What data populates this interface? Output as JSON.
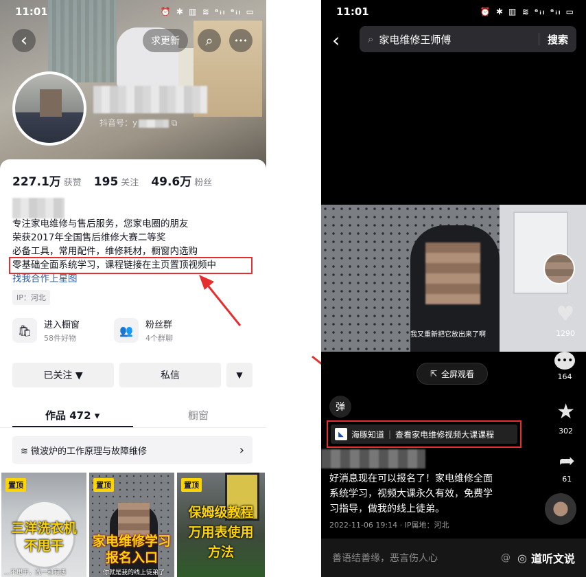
{
  "left": {
    "status_time": "11:01",
    "status_icons": "⏰ ✱ ▥ ≋ ᵃᵢₗ ᵃᵢₗ ▭",
    "back": "‹",
    "request_update": "求更新",
    "search": "⌕",
    "more": "•••",
    "douyin_id_label": "抖音号：y",
    "stats": [
      {
        "num": "227.1万",
        "label": "获赞"
      },
      {
        "num": "195",
        "label": "关注"
      },
      {
        "num": "49.6万",
        "label": "粉丝"
      }
    ],
    "bio_lines": [
      "专注家电维修与售后服务，您家电圈的朋友",
      "荣获2017年全国售后维修大赛二等奖",
      "必备工具，常用配件，维修耗材，橱窗内选购",
      "零基础全面系统学习，课程链接在主页置顶视频中"
    ],
    "star_link": "找我合作上星图",
    "ip": "IP：河北",
    "features": [
      {
        "title": "进入橱窗",
        "sub": "58件好物",
        "icon": "🛍"
      },
      {
        "title": "粉丝群",
        "sub": "4个群聊",
        "icon": "👥"
      }
    ],
    "follow_btn": "已关注 ▼",
    "message_btn": "私信",
    "dropdown_btn": "▼",
    "tabs": [
      "作品 472 ▾",
      "橱窗"
    ],
    "playlist": "微波炉的工作原理与故障维修",
    "playlist_chevron": "›",
    "pinned": "置顶",
    "thumbs": [
      {
        "caption": "三洋洗衣机\n不甩干",
        "foot": "…不甩干，洗一和有遇"
      },
      {
        "caption": "家电维修学习\n报名入口",
        "foot": "你就是我的线上徒弟了"
      },
      {
        "caption": "保姆级教程\n万用表使用\n方法",
        "foot": ""
      }
    ]
  },
  "right": {
    "status_time": "11:01",
    "status_icons": "⏰ ✱ ▥ ≋ ᵃᵢₗ ᵃᵢₗ ▭",
    "search_query": "家电维修王师傅",
    "search_btn": "搜索",
    "video_subtitle": "我又重新把它放出来了啊",
    "fullscreen": "全屏观看",
    "danmu": "弹",
    "likes": "1290",
    "comments": "164",
    "favorites": "302",
    "shares": "61",
    "course_brand": "海豚知道",
    "course_text": "查看家电维修视频大课课程",
    "description": [
      "好消息现在可以报名了！家电维修全面",
      "系统学习，视频大课永久有效，免费学",
      "习指导，做我的线上徒弟。"
    ],
    "meta": "2022-11-06 19:14 · IP属地：河北",
    "comment_placeholder": "善语结善缘，恶言伤人心",
    "watermark": "道听文说"
  },
  "annotation_color": "#e52f2f"
}
